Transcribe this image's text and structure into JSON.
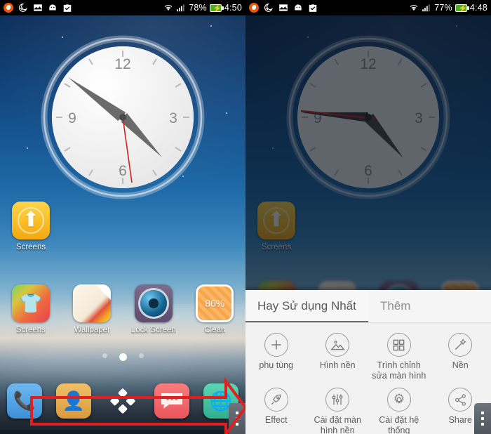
{
  "left_panel": {
    "status_bar": {
      "icons": [
        "notification-badge-icon",
        "do-not-disturb-moon-icon",
        "gallery-icon",
        "android-robot-icon",
        "task-checkbox-icon"
      ],
      "wifi_icon": "wifi-icon",
      "signal_icon": "signal-bars-icon",
      "battery_percent": "78%",
      "battery_icon": "battery-charging-icon",
      "time": "4:50"
    },
    "clock_widget": {
      "name": "analog-clock-widget",
      "numerals": [
        "12",
        "3",
        "6",
        "9"
      ],
      "hour_angle": 142,
      "minute_angle": 300,
      "second_angle": 173,
      "face_color": "#f7f7f7",
      "second_hand_color": "#cc2222"
    },
    "apps_row_1": [
      {
        "label": "Screens",
        "icon": "screens-up-arrow-icon"
      }
    ],
    "apps_row_2": [
      {
        "label": "Screens",
        "icon": "tshirt-icon"
      },
      {
        "label": "Wallpaper",
        "icon": "wallpaper-page-curl-icon"
      },
      {
        "label": "Lock Screen",
        "icon": "lock-screen-icon"
      },
      {
        "label": "Clean",
        "icon": "clean-icon",
        "badge": "86%"
      }
    ],
    "page_dots": {
      "count": 3,
      "active_index": 1
    },
    "dock": [
      {
        "name": "phone",
        "icon": "phone-icon"
      },
      {
        "name": "contacts",
        "icon": "contacts-person-icon"
      },
      {
        "name": "app-drawer",
        "icon": "app-drawer-diamond-icon"
      },
      {
        "name": "messages",
        "icon": "messages-bubble-icon"
      },
      {
        "name": "browser",
        "icon": "browser-globe-icon"
      }
    ],
    "overflow_handle": "overflow-menu-handle",
    "annotation": {
      "type": "red-arrow",
      "color": "#e02020"
    }
  },
  "right_panel": {
    "status_bar": {
      "icons": [
        "notification-badge-icon",
        "do-not-disturb-moon-icon",
        "gallery-icon",
        "android-robot-icon",
        "task-checkbox-icon"
      ],
      "wifi_icon": "wifi-icon",
      "signal_icon": "signal-bars-icon",
      "battery_percent": "77%",
      "battery_icon": "battery-charging-icon",
      "time": "4:48"
    },
    "clock_widget": {
      "name": "analog-clock-widget",
      "numerals": [
        "12",
        "3",
        "6",
        "9"
      ],
      "hour_angle": 145,
      "minute_angle": 260,
      "second_angle": 285,
      "face_color": "#8d8d8d",
      "second_hand_color": "#8e2020"
    },
    "apps_row_1": [
      {
        "label": "Screens",
        "icon": "screens-up-arrow-icon"
      }
    ],
    "menu_sheet": {
      "tabs": [
        {
          "label": "Hay Sử dụng Nhất",
          "active": true
        },
        {
          "label": "Thêm",
          "active": false
        }
      ],
      "items": [
        {
          "label": "phụ tùng",
          "icon": "plus-icon"
        },
        {
          "label": "Hình nền",
          "icon": "image-mountain-icon"
        },
        {
          "label": "Trình chỉnh sửa màn hình",
          "icon": "grid-squares-icon"
        },
        {
          "label": "Nền",
          "icon": "magic-wand-icon"
        },
        {
          "label": "Effect",
          "icon": "rocket-icon"
        },
        {
          "label": "Cài đặt màn hình nền",
          "icon": "sliders-icon"
        },
        {
          "label": "Cài đặt hệ thống",
          "icon": "gear-icon"
        },
        {
          "label": "Share",
          "icon": "share-icon"
        }
      ]
    },
    "overflow_handle": "overflow-menu-handle"
  }
}
